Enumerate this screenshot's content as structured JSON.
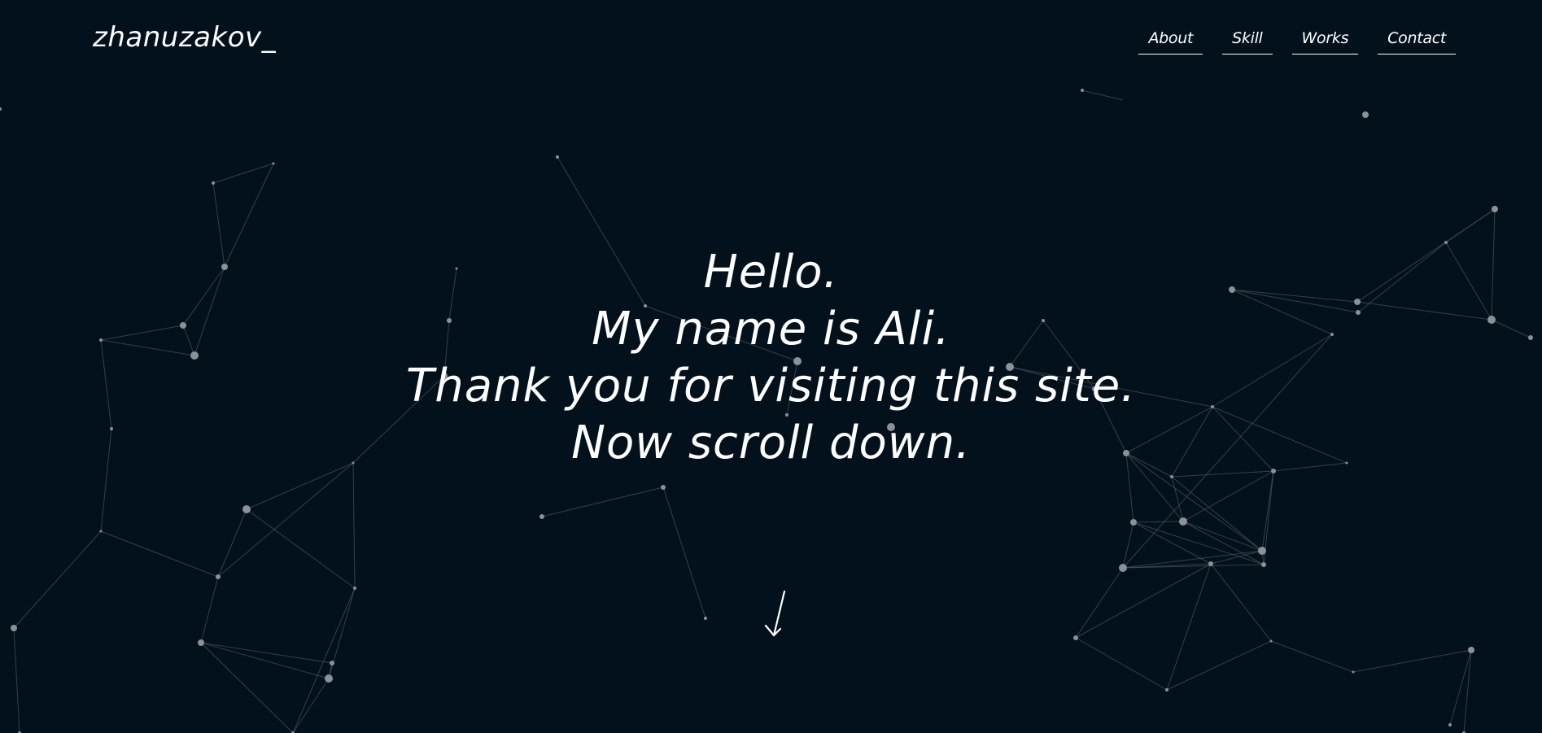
{
  "header": {
    "logo_text": "zhanuzakov_",
    "nav": [
      {
        "label": "About"
      },
      {
        "label": "Skill"
      },
      {
        "label": "Works"
      },
      {
        "label": "Contact"
      }
    ]
  },
  "hero": {
    "lines": [
      "Hello.",
      "My name is Ali.",
      "Thank you for visiting this site.",
      "Now scroll down."
    ],
    "scroll_icon": "arrow-down-icon"
  },
  "colors": {
    "background": "#03111c",
    "text": "#ffffff",
    "particle": "#8a9199",
    "link_line": "#4a545c"
  }
}
